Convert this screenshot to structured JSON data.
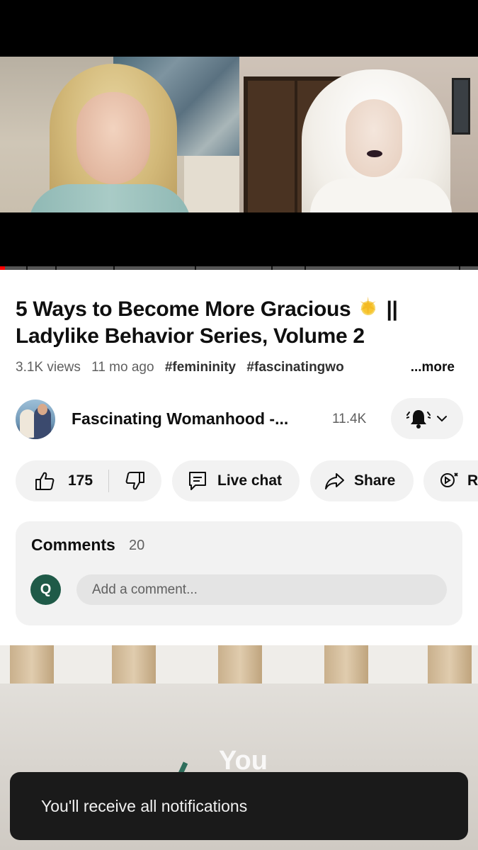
{
  "video": {
    "title_line1": "5 Ways to Become More Gracious",
    "title_emoji": "sun-emoji",
    "title_line1_suffix": "||",
    "title_line2": "Ladylike Behavior Series, Volume 2",
    "progress_fraction": 0.01
  },
  "meta": {
    "views": "3.1K views",
    "age": "11 mo ago",
    "tag1": "#femininity",
    "tag2": "#fascinatingwo",
    "more": "...more"
  },
  "channel": {
    "name": "Fascinating Womanhood -...",
    "subscribers": "11.4K",
    "notification_icon": "bell-ring-icon"
  },
  "actions": {
    "likes": "175",
    "live_chat": "Live chat",
    "share": "Share",
    "remix": "R"
  },
  "comments": {
    "heading": "Comments",
    "count": "20",
    "user_initial": "Q",
    "placeholder": "Add a comment..."
  },
  "next_video": {
    "visible_text": "You"
  },
  "toast": {
    "message": "You'll receive all notifications"
  },
  "colors": {
    "progress_played": "#ff0000",
    "pill_bg": "#f2f2f2",
    "avatar_q_bg": "#1f5a48",
    "toast_bg": "#1a1a1a"
  }
}
